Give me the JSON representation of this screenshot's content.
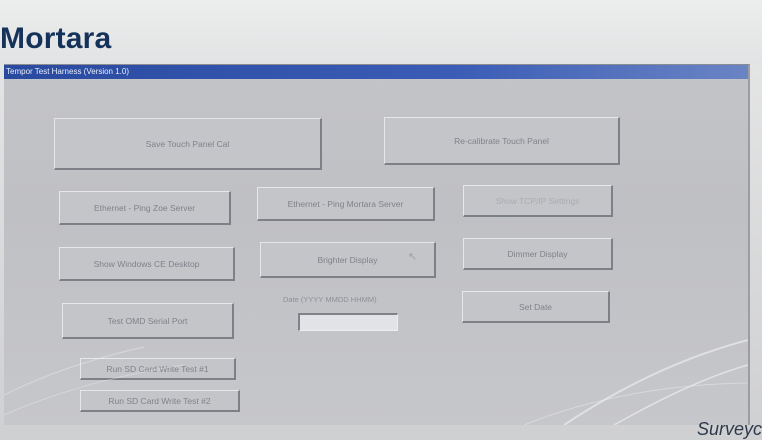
{
  "brand": {
    "logo_text": "Mortara"
  },
  "window": {
    "title": "Tempor Test Harness (Version 1.0)"
  },
  "buttons": {
    "save_touch_panel_cal": "Save Touch Panel Cal",
    "recalibrate_touch_panel": "Re-calibrate Touch Panel",
    "ethernet_ping_zoe": "Ethernet - Ping Zoe Server",
    "ethernet_ping_mortara": "Ethernet - Ping Mortara Server",
    "show_tcpip_settings": "Show TCP/IP Settings",
    "show_windows_ce_desktop": "Show Windows CE Desktop",
    "brighter_display": "Brighter Display",
    "dimmer_display": "Dimmer Display",
    "test_omd_serial_port": "Test OMD Serial Port",
    "set_date": "Set Date",
    "run_sd_test_1": "Run SD Card Write Test #1",
    "run_sd_test_2": "Run SD Card Write Test #2"
  },
  "date_field": {
    "label": "Date (YYYY MMDD HHMM)",
    "value": ""
  },
  "watermark": {
    "text": "Surveyc"
  }
}
